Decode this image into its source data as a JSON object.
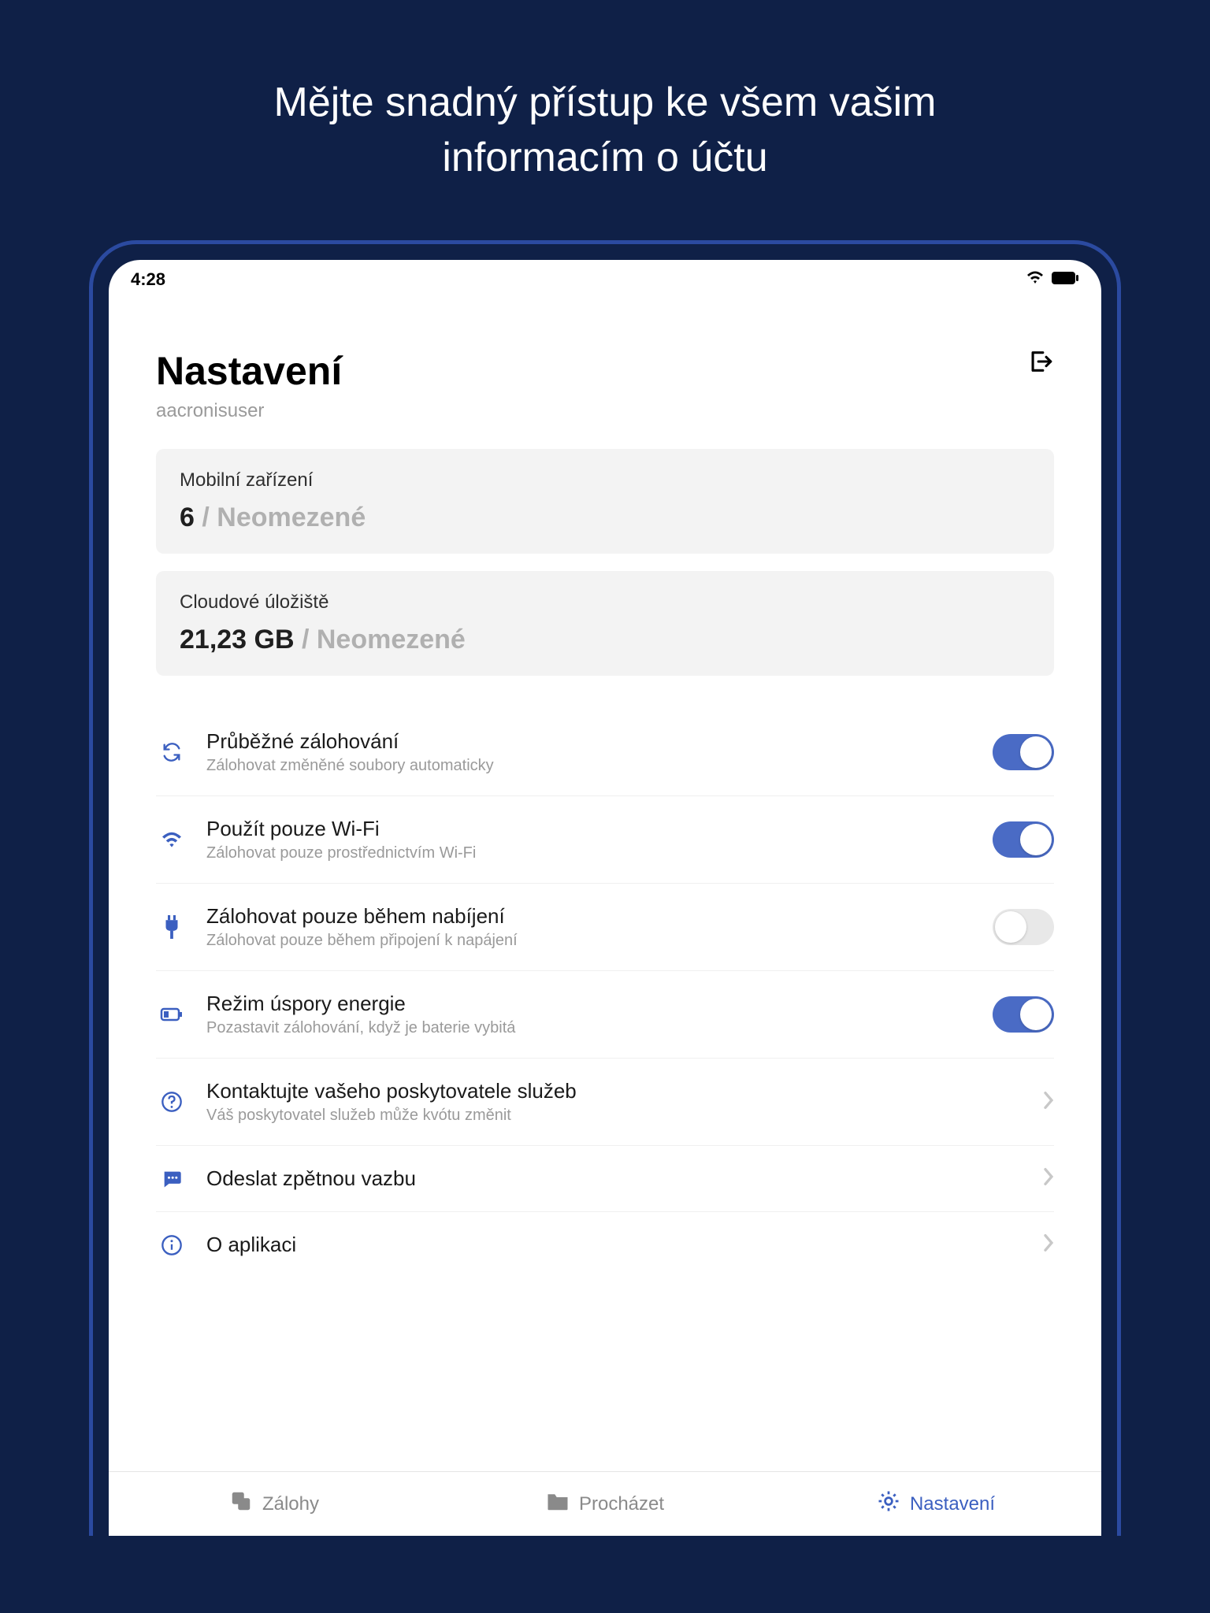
{
  "promo": {
    "line1": "Mějte snadný přístup ke všem vašim",
    "line2": "informacím o účtu"
  },
  "status_bar": {
    "time": "4:28"
  },
  "header": {
    "title": "Nastavení",
    "username": "aacronisuser"
  },
  "cards": {
    "devices": {
      "label": "Mobilní zařízení",
      "value": "6",
      "limit_separator": " / ",
      "limit": "Neomezené"
    },
    "storage": {
      "label": "Cloudové úložiště",
      "value": "21,23 GB",
      "limit_separator": " / ",
      "limit": "Neomezené"
    }
  },
  "settings": {
    "continuous": {
      "title": "Průběžné zálohování",
      "sub": "Zálohovat změněné soubory automaticky",
      "on": true
    },
    "wifi": {
      "title": "Použít pouze Wi-Fi",
      "sub": "Zálohovat pouze prostřednictvím Wi-Fi",
      "on": true
    },
    "charging": {
      "title": "Zálohovat pouze během nabíjení",
      "sub": "Zálohovat pouze během připojení k napájení",
      "on": false
    },
    "powersave": {
      "title": "Režim úspory energie",
      "sub": "Pozastavit zálohování, když je baterie vybitá",
      "on": true
    },
    "contact": {
      "title": "Kontaktujte vašeho poskytovatele služeb",
      "sub": "Váš poskytovatel služeb může kvótu změnit"
    },
    "feedback": {
      "title": "Odeslat zpětnou vazbu"
    },
    "about": {
      "title": "O aplikaci"
    }
  },
  "tabs": {
    "backups": "Zálohy",
    "browse": "Procházet",
    "settings": "Nastavení"
  }
}
